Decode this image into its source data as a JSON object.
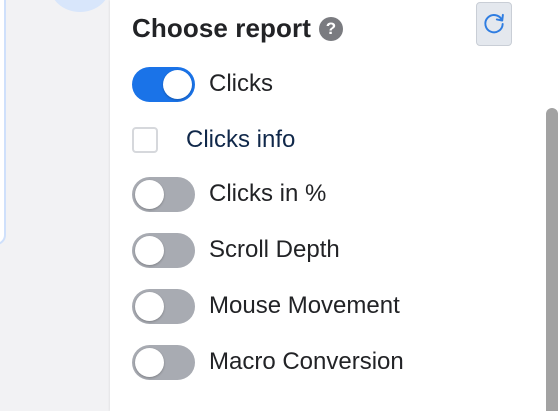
{
  "panel": {
    "title": "Choose report",
    "help_icon_glyph": "?",
    "refresh_icon": "refresh-icon"
  },
  "reports": [
    {
      "label": "Clicks",
      "type": "toggle",
      "on": true
    },
    {
      "label": "Clicks info",
      "type": "checkbox",
      "checked": false
    },
    {
      "label": "Clicks in %",
      "type": "toggle",
      "on": false
    },
    {
      "label": "Scroll Depth",
      "type": "toggle",
      "on": false
    },
    {
      "label": "Mouse Movement",
      "type": "toggle",
      "on": false
    },
    {
      "label": "Macro Conversion",
      "type": "toggle",
      "on": false
    }
  ],
  "colors": {
    "toggle_on": "#1a73e8",
    "toggle_off": "#a8abb2",
    "help_icon": "#7a7b80",
    "checkbox_label": "#10284a"
  }
}
